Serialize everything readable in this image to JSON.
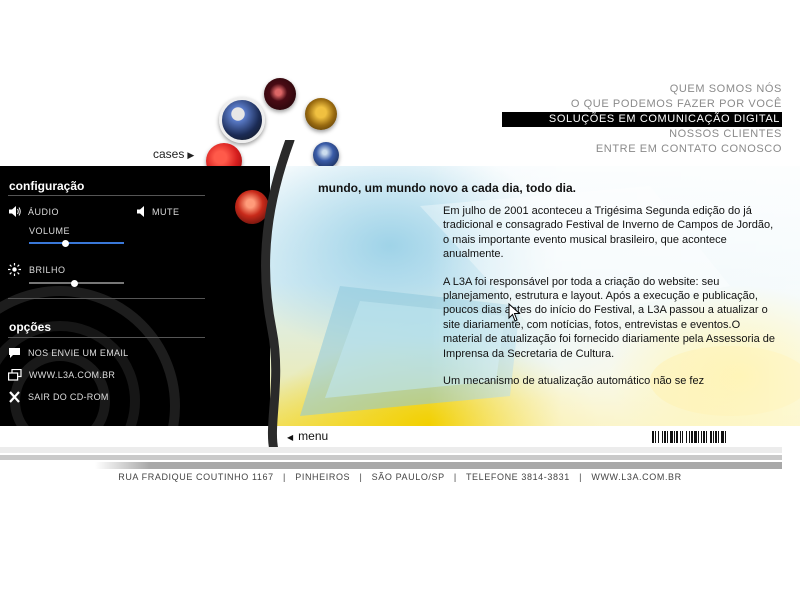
{
  "nav": {
    "items": [
      {
        "label": "QUEM SOMOS NÓS"
      },
      {
        "label": "O QUE PODEMOS FAZER POR VOCÊ"
      },
      {
        "label": "SOLUÇÕES EM COMUNICAÇÃO DIGITAL"
      },
      {
        "label": "NOSSOS CLIENTES"
      },
      {
        "label": "ENTRE EM CONTATO CONOSCO"
      }
    ],
    "active_index": 2
  },
  "cases": {
    "label": "cases"
  },
  "config": {
    "title": "configuração",
    "audio_label": "ÁUDIO",
    "mute_label": "MUTE",
    "volume_label": "VOLUME",
    "volume_level": 0.38,
    "brightness_label": "BRILHO",
    "brightness_level": 0.48
  },
  "options": {
    "title": "opções",
    "items": [
      {
        "label": "NOS ENVIE UM EMAIL",
        "icon": "speech-bubble-icon"
      },
      {
        "label": "WWW.L3A.COM.BR",
        "icon": "windows-icon"
      },
      {
        "label": "SAIR DO CD-ROM",
        "icon": "close-icon"
      }
    ]
  },
  "content": {
    "headline": "mundo, um mundo novo a cada dia, todo dia.",
    "paragraphs": [
      "Em julho de 2001 aconteceu a Trigésima Segunda edição do já tradicional e consagrado Festival de Inverno de Campos de Jordão, o mais importante evento musical brasileiro, que acontece anualmente.",
      "A L3A foi responsável por toda a criação do website: seu planejamento, estrutura e layout. Após a execução e publicação, poucos dias antes do início do Festival, a L3A passou a atualizar o site diariamente, com notícias, fotos, entrevistas e eventos.O material de atualização foi fornecido diariamente pela Assessoria de Imprensa da Secretaria de Cultura.",
      "Um mecanismo de atualização automático não se fez"
    ]
  },
  "menu": {
    "label": "menu"
  },
  "footer": {
    "text": "RUA FRADIQUE COUTINHO 1167   |   PINHEIROS   |   SÃO PAULO/SP   |   TELEFONE 3814-3831   |   WWW.L3A.COM.BR"
  },
  "colors": {
    "slider_accent": "#3a78d8",
    "nav_active_bg": "#000000",
    "nav_text": "#8a8a8a"
  }
}
